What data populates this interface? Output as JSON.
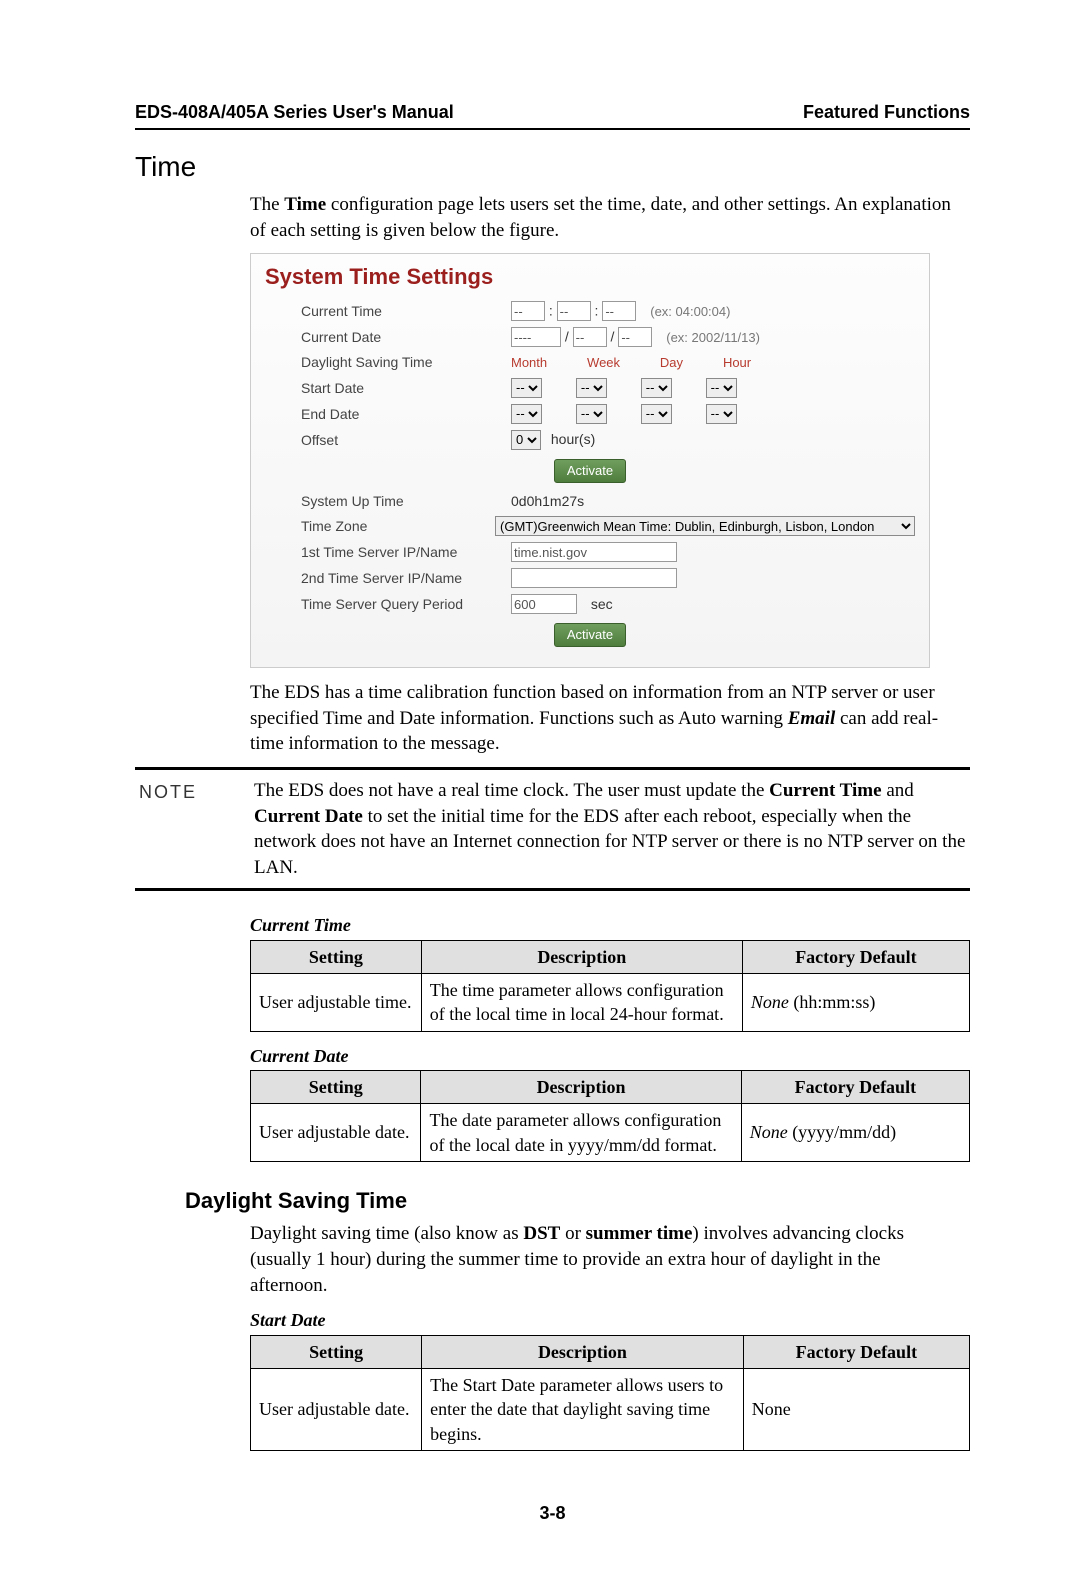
{
  "header": {
    "left": "EDS-408A/405A Series User's Manual",
    "right": "Featured Functions"
  },
  "section": {
    "title": "Time"
  },
  "intro": {
    "pre": "The ",
    "time_bold": "Time",
    "post": " configuration page lets users set the time, date, and other settings. An explanation of each setting is given below the figure."
  },
  "shot": {
    "title": "System Time Settings",
    "rows": {
      "current_time_lbl": "Current Time",
      "ct_v1": "--",
      "ct_v2": "--",
      "ct_v3": "--",
      "ct_hint": "(ex: 04:00:04)",
      "current_date_lbl": "Current Date",
      "cd_v1": "----",
      "cd_v2": "--",
      "cd_v3": "--",
      "cd_hint": "(ex: 2002/11/13)",
      "dst_lbl": "Daylight Saving Time",
      "dst_h_month": "Month",
      "dst_h_week": "Week",
      "dst_h_day": "Day",
      "dst_h_hour": "Hour",
      "start_lbl": "Start Date",
      "end_lbl": "End Date",
      "sel": "--",
      "offset_lbl": "Offset",
      "offset_val": "0",
      "offset_unit": "hour(s)",
      "activate": "Activate",
      "uptime_lbl": "System Up Time",
      "uptime_val": "0d0h1m27s",
      "tz_lbl": "Time Zone",
      "tz_val": "(GMT)Greenwich Mean Time: Dublin, Edinburgh, Lisbon, London",
      "ts1_lbl": "1st Time Server IP/Name",
      "ts1_val": "time.nist.gov",
      "ts2_lbl": "2nd Time Server IP/Name",
      "ts2_val": "",
      "tsq_lbl": "Time Server Query Period",
      "tsq_val": "600",
      "tsq_unit": "sec"
    }
  },
  "after_shot": {
    "pre": "The EDS has a time calibration function based on information from an NTP server or user specified Time and Date information. Functions such as Auto warning ",
    "email": "Email",
    "post": " can add real-time information to the message."
  },
  "note": {
    "label": "NOTE",
    "t1": "The EDS does not have a real time clock. The user must update the ",
    "b1": "Current Time",
    "t2": " and ",
    "b2": "Current Date",
    "t3": " to set the initial time for the EDS after each reboot, especially when the network does not have an Internet connection for NTP server or there is no NTP server on the LAN."
  },
  "colhdr": {
    "setting": "Setting",
    "description": "Description",
    "default": "Factory Default"
  },
  "current_time_tbl": {
    "title": "Current Time",
    "setting": "User adjustable time.",
    "desc": "The time parameter allows configuration of the local time in local 24-hour format.",
    "def_i": "None",
    "def_rest": " (hh:mm:ss)"
  },
  "current_date_tbl": {
    "title": "Current Date",
    "setting": "User adjustable date.",
    "desc": "The date parameter allows configuration of the local date in yyyy/mm/dd format.",
    "def_i": "None",
    "def_rest": " (yyyy/mm/dd)"
  },
  "dst_section": {
    "title": "Daylight Saving Time",
    "p1": "Daylight saving time (also know as ",
    "b1": "DST",
    "p2": " or ",
    "b2": "summer time",
    "p3": ") involves advancing clocks (usually 1 hour) during the summer time to provide an extra hour of daylight in the afternoon."
  },
  "start_date_tbl": {
    "title": "Start Date",
    "setting": "User adjustable date.",
    "desc": "The Start Date parameter allows users to enter the date that daylight saving time begins.",
    "def": "None"
  },
  "pagenum": "3-8"
}
